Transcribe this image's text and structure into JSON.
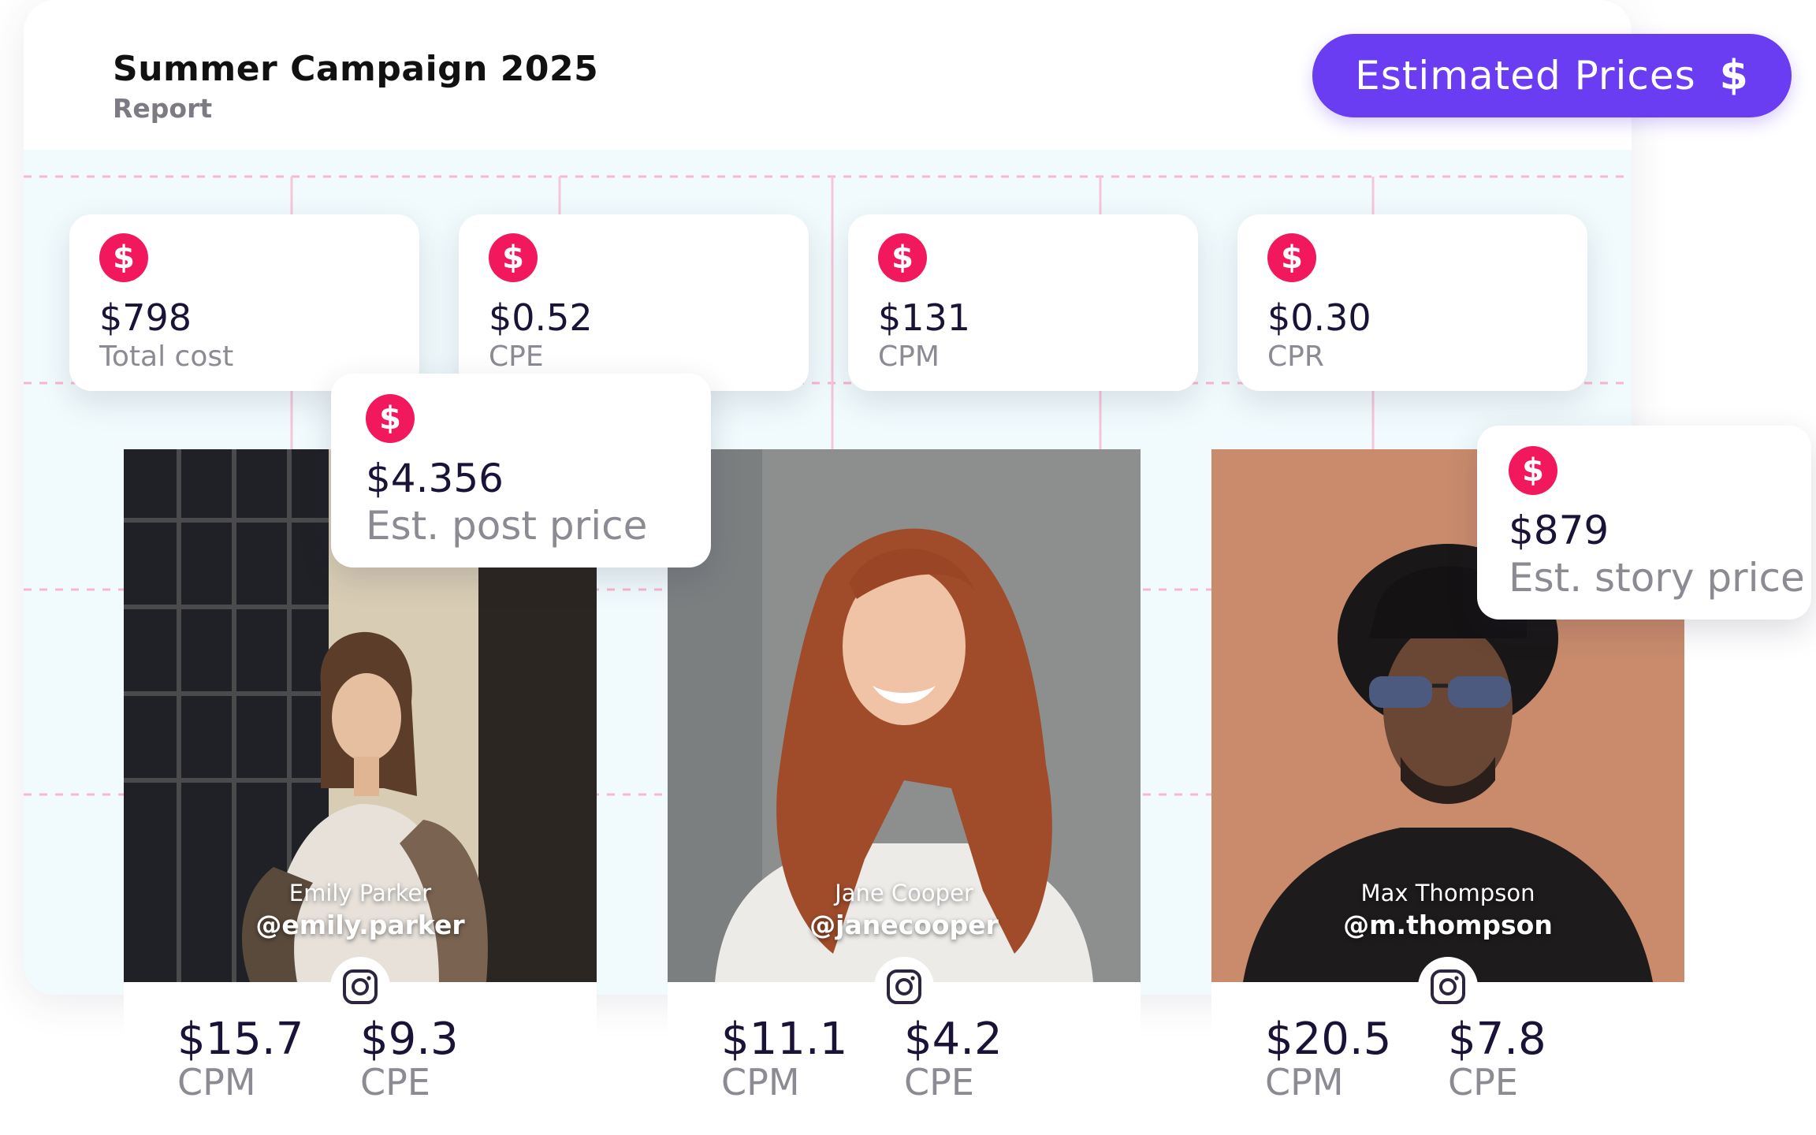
{
  "header": {
    "title": "Summer Campaign 2025",
    "subtitle": "Report"
  },
  "action_button": {
    "label": "Estimated Prices",
    "icon": "dollar-icon",
    "color": "#6a3df2"
  },
  "accent_color": "#f2185e",
  "stats": [
    {
      "value": "$798",
      "label": "Total cost"
    },
    {
      "value": "$0.52",
      "label": "CPE"
    },
    {
      "value": "$131",
      "label": "CPM"
    },
    {
      "value": "$0.30",
      "label": "CPR"
    }
  ],
  "post_price": {
    "value": "$4.356",
    "label": "Est. post price"
  },
  "story_price": {
    "value": "$879",
    "label": "Est. story price"
  },
  "influencers": [
    {
      "name": "Emily Parker",
      "handle": "@emily.parker",
      "platform": "instagram-icon",
      "cpm_value": "$15.7",
      "cpm_label": "CPM",
      "cpe_value": "$9.3",
      "cpe_label": "CPE"
    },
    {
      "name": "Jane Cooper",
      "handle": "@janecooper",
      "platform": "instagram-icon",
      "cpm_value": "$11.1",
      "cpm_label": "CPM",
      "cpe_value": "$4.2",
      "cpe_label": "CPE"
    },
    {
      "name": "Max Thompson",
      "handle": "@m.thompson",
      "platform": "instagram-icon",
      "cpm_value": "$20.5",
      "cpm_label": "CPM",
      "cpe_value": "$7.8",
      "cpe_label": "CPE"
    }
  ]
}
